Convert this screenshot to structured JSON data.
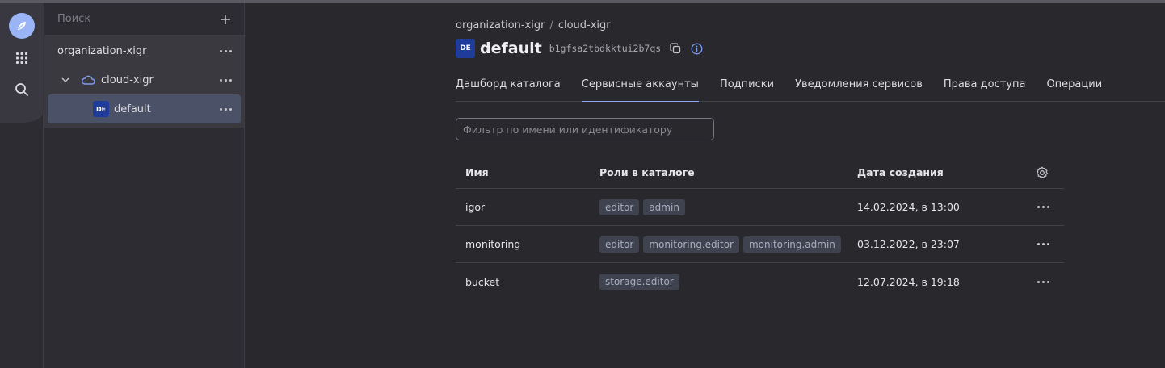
{
  "tree": {
    "search_placeholder": "Поиск",
    "organization": "organization-xigr",
    "cloud": "cloud-xigr",
    "folder": "default",
    "folder_badge": "DE"
  },
  "header": {
    "breadcrumb": [
      "organization-xigr",
      "cloud-xigr"
    ],
    "breadcrumb_separator": "/",
    "title": "default",
    "title_badge": "DE",
    "folder_id": "b1gfsa2tbdkktui2b7qs"
  },
  "tabs": [
    {
      "label": "Дашборд каталога",
      "active": false
    },
    {
      "label": "Сервисные аккаунты",
      "active": true
    },
    {
      "label": "Подписки",
      "active": false
    },
    {
      "label": "Уведомления сервисов",
      "active": false
    },
    {
      "label": "Права доступа",
      "active": false
    },
    {
      "label": "Операции",
      "active": false
    }
  ],
  "filter": {
    "placeholder": "Фильтр по имени или идентификатору"
  },
  "table": {
    "columns": [
      "Имя",
      "Роли в каталоге",
      "Дата создания"
    ],
    "rows": [
      {
        "name": "igor",
        "roles": [
          "editor",
          "admin"
        ],
        "created": "14.02.2024, в 13:00"
      },
      {
        "name": "monitoring",
        "roles": [
          "editor",
          "monitoring.editor",
          "monitoring.admin"
        ],
        "created": "03.12.2022, в 23:07"
      },
      {
        "name": "bucket",
        "roles": [
          "storage.editor"
        ],
        "created": "12.07.2024, в 19:18"
      }
    ]
  },
  "colors": {
    "accent": "#8aa6f5",
    "folder_badge": "#1f3c9a",
    "selected_row": "#4b5166",
    "role_chip": "#3f4350"
  },
  "icons": {
    "rail": [
      "logo-icon",
      "apps-grid-icon",
      "search-icon"
    ],
    "tree": [
      "plus-icon",
      "chevron-down-icon",
      "cloud-icon",
      "more-icon"
    ],
    "header": [
      "copy-icon",
      "info-icon"
    ],
    "table": [
      "settings-gear-icon",
      "more-icon"
    ]
  }
}
